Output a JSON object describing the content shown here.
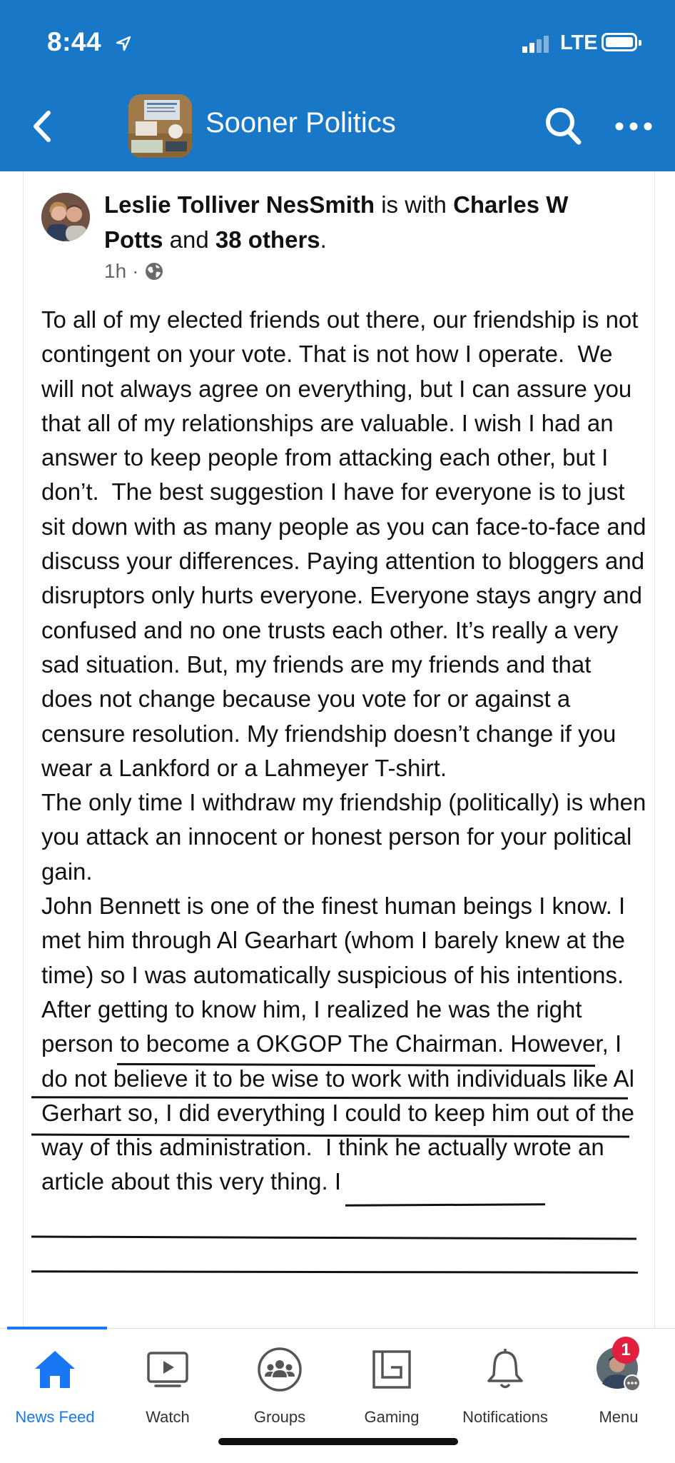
{
  "status_bar": {
    "time": "8:44",
    "network": "LTE"
  },
  "header": {
    "title": "Sooner Politics",
    "back_icon": "chevron-left-icon",
    "search_icon": "search-icon",
    "more_icon": "more-horizontal-icon"
  },
  "post": {
    "author": "Leslie Tolliver NesSmith",
    "with_text": " is with ",
    "tagged": "Charles W Potts",
    "and_text": " and ",
    "others": "38 others",
    "period": ".",
    "time": "1h",
    "privacy_icon": "globe-icon",
    "paragraphs": [
      "To all of my elected friends out there, our friendship is not contingent on your vote. That is not how I operate.  We will not always agree on everything, but I can assure you that all of my relationships are valuable. I wish I had an answer to keep people from attacking each other, but I don’t.  The best suggestion I have for everyone is to just sit down with as many people as you can face-to-face and discuss your differences. Paying attention to bloggers and disruptors only hurts everyone. Everyone stays angry and confused and no one trusts each other. It’s really a very sad situation. But, my friends are my friends and that does not change because you vote for or against a censure resolution. My friendship doesn’t change if you wear a Lankford or a Lahmeyer T-shirt.",
      "The only time I withdraw my friendship (politically) is when you attack an innocent or honest person for your political gain.",
      "John Bennett is one of the finest human beings I know. I met him through Al Gearhart (whom I barely knew at the time) so I was automatically suspicious of his intentions. After getting to know him, I realized he was the right person to become a OKGOP The Chairman. However, I do not believe it to be wise to work with individuals like Al Gerhart so, I did everything I could to keep him out of the way of this administration.  I think he actually wrote an article about this very thing. I"
    ]
  },
  "tabs": [
    {
      "label": "News Feed",
      "icon": "home-icon"
    },
    {
      "label": "Watch",
      "icon": "video-icon"
    },
    {
      "label": "Groups",
      "icon": "groups-icon"
    },
    {
      "label": "Gaming",
      "icon": "gaming-icon"
    },
    {
      "label": "Notifications",
      "icon": "bell-icon"
    },
    {
      "label": "Menu",
      "icon": "profile-menu-icon"
    }
  ],
  "menu_badge": "1"
}
